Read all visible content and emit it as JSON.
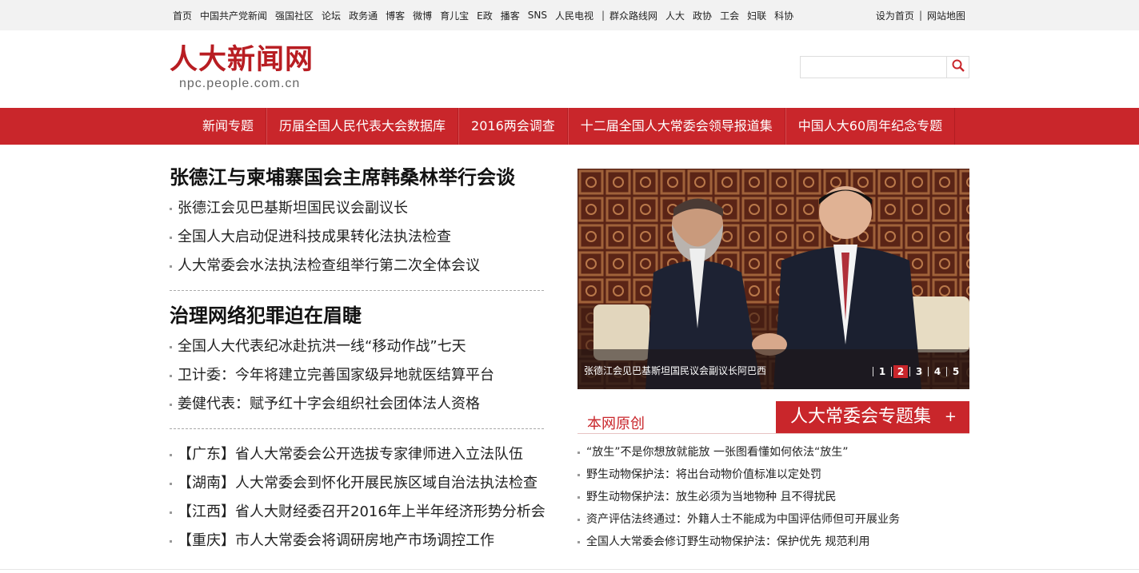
{
  "topnav": {
    "items": [
      "首页",
      "中国共产党新闻",
      "强国社区",
      "论坛",
      "政务通",
      "博客",
      "微博",
      "育儿宝",
      "E政",
      "播客",
      "SNS",
      "人民电视"
    ],
    "items2": [
      "群众路线网",
      "人大",
      "政协",
      "工会",
      "妇联",
      "科协"
    ],
    "right": [
      "设为首页",
      "网站地图"
    ]
  },
  "header": {
    "logo_cn": "人大新闻网",
    "logo_en": "npc.people.com.cn",
    "search_placeholder": "",
    "search_icon": "search-icon"
  },
  "mainnav": [
    "新闻专题",
    "历届全国人民代表大会数据库",
    "2016两会调查",
    "十二届全国人大常委会领导报道集",
    "中国人大60周年纪念专题"
  ],
  "left": {
    "headline1": "张德江与柬埔寨国会主席韩桑林举行会谈",
    "list1": [
      "张德江会见巴基斯坦国民议会副议长",
      "全国人大启动促进科技成果转化法执法检查",
      "人大常委会水法执法检查组举行第二次全体会议"
    ],
    "headline2": "治理网络犯罪迫在眉睫",
    "list2": [
      "全国人大代表纪冰赴抗洪一线“移动作战”七天",
      "卫计委：今年将建立完善国家级异地就医结算平台",
      "姜健代表：赋予红十字会组织社会团体法人资格"
    ],
    "list3": [
      "【广东】省人大常委会公开选拔专家律师进入立法队伍",
      "【湖南】人大常委会到怀化开展民族区域自治法执法检查",
      "【江西】省人大财经委召开2016年上半年经济形势分析会",
      "【重庆】市人大常委会将调研房地产市场调控工作"
    ]
  },
  "slider": {
    "caption": "张德江会见巴基斯坦国民议会副议长阿巴西",
    "pages": [
      "1",
      "2",
      "3",
      "4",
      "5"
    ],
    "active_page": "2"
  },
  "right": {
    "original_label": "本网原创",
    "special_title": "人大常委会专题集",
    "special_plus": "+",
    "list": [
      "“放生”不是你想放就能放 一张图看懂如何依法“放生”",
      "野生动物保护法：将出台动物价值标准以定处罚",
      "野生动物保护法：放生必须为当地物种 且不得扰民",
      "资产评估法终通过：外籍人士不能成为中国评估师但可开展业务",
      "全国人大常委会修订野生动物保护法：保护优先 规范利用"
    ]
  },
  "colors": {
    "brand_red": "#c9262b",
    "logo_red": "#b81d22"
  }
}
